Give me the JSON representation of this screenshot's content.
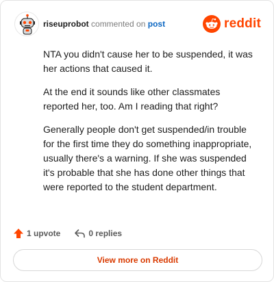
{
  "header": {
    "username": "riseuprobot",
    "commented_text": "commented on",
    "post_link": "post",
    "brand_name": "reddit"
  },
  "comment": {
    "paragraphs": [
      "NTA you didn't cause her to be suspended, it was her actions that caused it.",
      "At the end it sounds like other classmates reported her, too. Am I reading that right?",
      "Generally people don't get suspended/in trouble for the first time they do something inappropriate, usually there's a warning. If she was suspended it's probable that she has done other things that were reported to the student department."
    ]
  },
  "actions": {
    "upvote_label": "1 upvote",
    "replies_label": "0 replies"
  },
  "footer": {
    "view_more_label": "View more on Reddit"
  },
  "colors": {
    "brand": "#ff4500",
    "link": "#0a66c2",
    "view_more_text": "#d93a00"
  },
  "icons": {
    "avatar": "snoo-robot-avatar-icon",
    "brand": "reddit-logo-icon",
    "upvote": "upvote-arrow-icon",
    "reply": "reply-arrow-icon"
  }
}
